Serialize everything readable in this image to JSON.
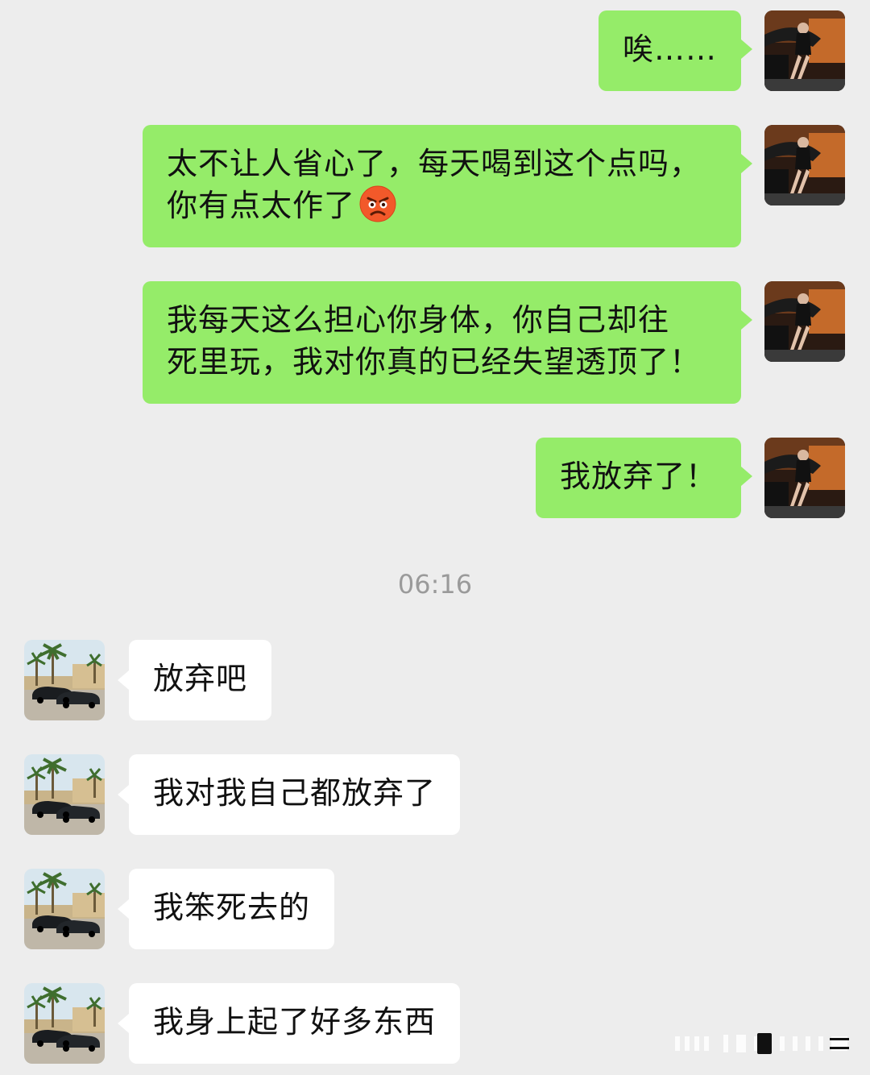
{
  "timestamp": "06:16",
  "avatars": {
    "me": "woman-in-car-avatar",
    "them": "palm-trees-cars-avatar"
  },
  "messages": [
    {
      "side": "me",
      "lines": [
        "唉……"
      ]
    },
    {
      "side": "me",
      "lines": [
        "太不让人省心了，每天喝到这个点吗，",
        "你有点太作了"
      ],
      "emoji": "angry-face-emoji"
    },
    {
      "side": "me",
      "lines": [
        "我每天这么担心你身体，你自己却往",
        "死里玩，我对你真的已经失望透顶了！"
      ]
    },
    {
      "side": "me",
      "lines": [
        "我放弃了！"
      ]
    },
    {
      "side": "them",
      "lines": [
        "放弃吧"
      ]
    },
    {
      "side": "them",
      "lines": [
        "我对我自己都放弃了"
      ]
    },
    {
      "side": "them",
      "lines": [
        "我笨死去的"
      ]
    },
    {
      "side": "them",
      "lines": [
        "我身上起了好多东西"
      ]
    }
  ]
}
